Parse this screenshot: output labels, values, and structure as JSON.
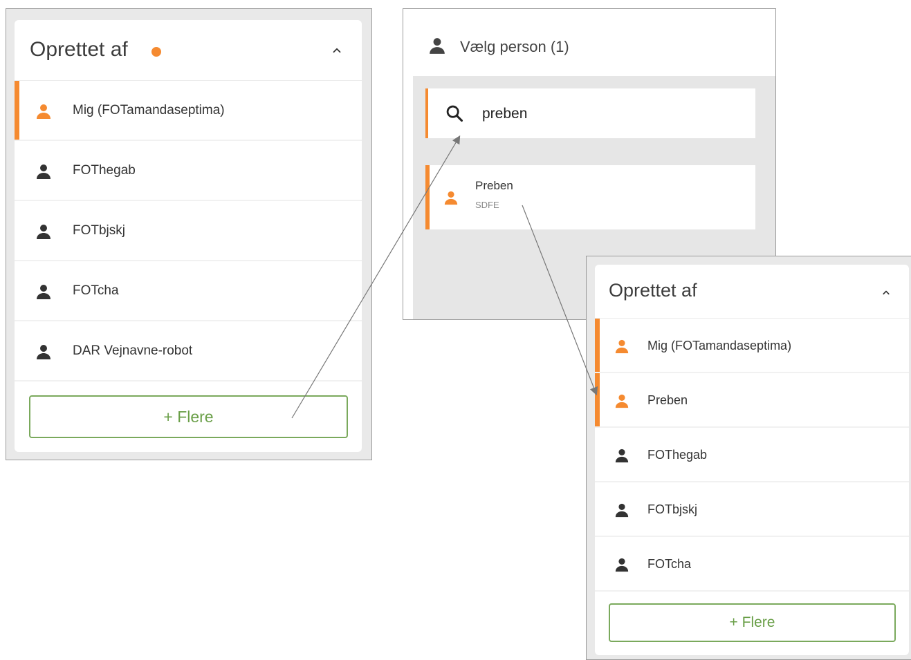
{
  "left_card": {
    "title": "Oprettet af",
    "status_dot_color": "#f58a30",
    "items": [
      {
        "label": "Mig (FOTamandaseptima)",
        "selected": true
      },
      {
        "label": "FOThegab",
        "selected": false
      },
      {
        "label": "FOTbjskj",
        "selected": false
      },
      {
        "label": "FOTcha",
        "selected": false
      },
      {
        "label": "DAR Vejnavne-robot",
        "selected": false
      }
    ],
    "more_button": "+ Flere"
  },
  "picker": {
    "title": "Vælg person (1)",
    "search_value": "preben",
    "results": [
      {
        "name": "Preben",
        "subtitle": "SDFE"
      }
    ]
  },
  "right_card": {
    "title": "Oprettet af",
    "items": [
      {
        "label": "Mig (FOTamandaseptima)",
        "selected": true
      },
      {
        "label": "Preben",
        "selected": true
      },
      {
        "label": "FOThegab",
        "selected": false
      },
      {
        "label": "FOTbjskj",
        "selected": false
      },
      {
        "label": "FOTcha",
        "selected": false
      }
    ],
    "more_button": "+ Flere"
  },
  "colors": {
    "accent": "#f58a30",
    "button_green": "#6a9f48",
    "icon_dark": "#333333"
  },
  "icons": {
    "person": "person-icon",
    "search": "search-icon",
    "collapse": "chevron-up-icon"
  }
}
